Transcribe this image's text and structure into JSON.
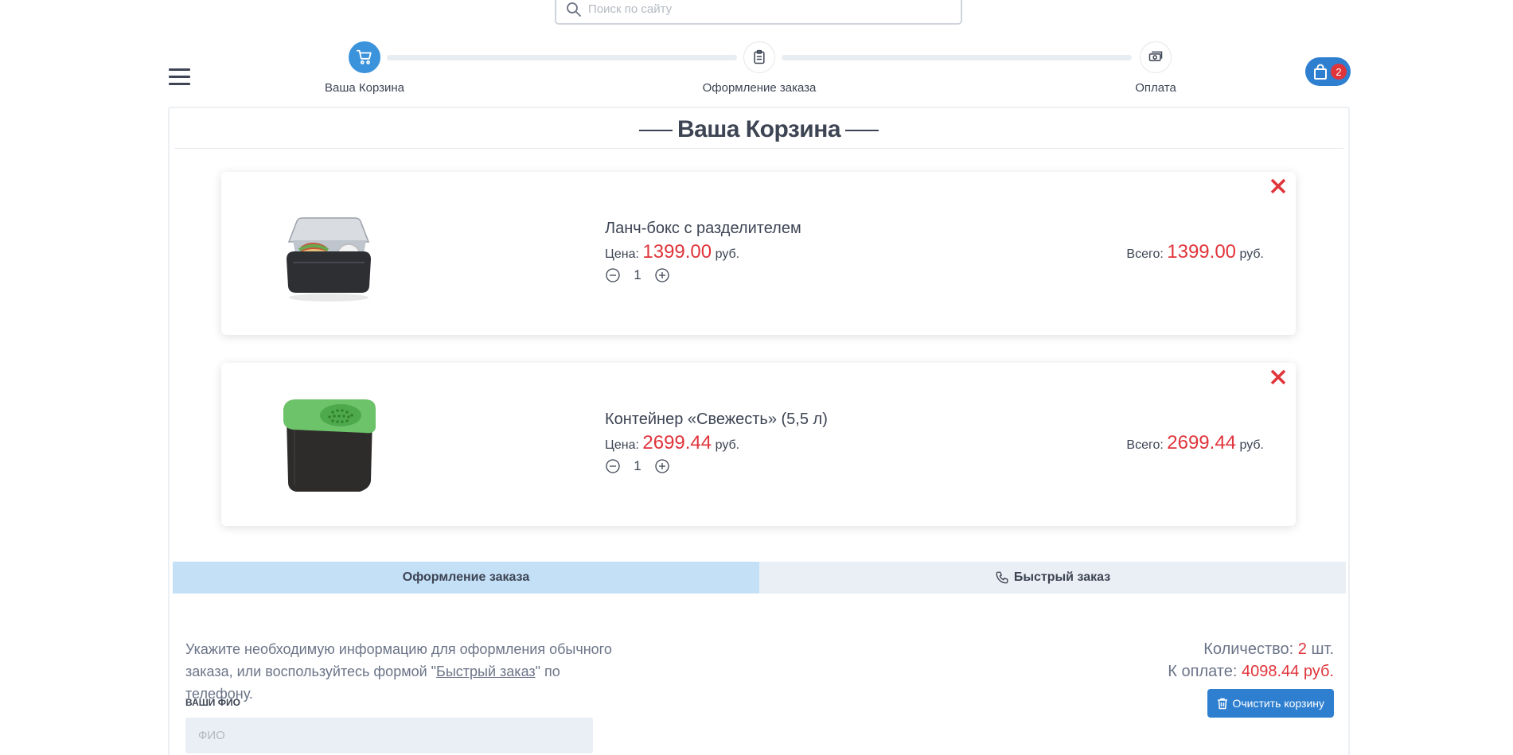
{
  "search": {
    "placeholder": "Поиск по сайту"
  },
  "stepper": {
    "steps": [
      {
        "label": "Ваша Корзина",
        "icon": "cart-icon",
        "active": true
      },
      {
        "label": "Оформление заказа",
        "icon": "clipboard-icon",
        "active": false
      },
      {
        "label": "Оплата",
        "icon": "cash-icon",
        "active": false
      }
    ]
  },
  "cart_badge": {
    "count": "2"
  },
  "cart": {
    "title": "Ваша Корзина",
    "items": [
      {
        "name": "Ланч-бокс с разделителем",
        "price_label": "Цена:",
        "price": "1399.00",
        "currency": "руб.",
        "quantity": "1",
        "total_label": "Всего:",
        "total": "1399.00"
      },
      {
        "name": "Контейнер «Свежесть» (5,5 л)",
        "price_label": "Цена:",
        "price": "2699.44",
        "currency": "руб.",
        "quantity": "1",
        "total_label": "Всего:",
        "total": "2699.44"
      }
    ]
  },
  "tabs": [
    {
      "label": "Оформление заказа",
      "active": true
    },
    {
      "label": "Быстрый заказ",
      "icon": "phone-icon",
      "active": false
    }
  ],
  "checkout": {
    "info_prefix": "Укажите необходимую информацию для оформления обычного заказа, или воспользуйтесь формой \"",
    "info_link": "Быстрый заказ",
    "info_suffix": "\" по телефону.",
    "fio_label": "ВАШИ ФИО",
    "fio_placeholder": "ФИО"
  },
  "summary": {
    "qty_label": "Количество:",
    "qty_value": "2",
    "qty_unit": "шт.",
    "pay_label": "К оплате:",
    "pay_value": "4098.44 руб.",
    "clear_label": "Очистить корзину"
  },
  "colors": {
    "accent": "#2f7fd0",
    "price": "#e0343b",
    "active_tab": "#c3e0f7"
  }
}
